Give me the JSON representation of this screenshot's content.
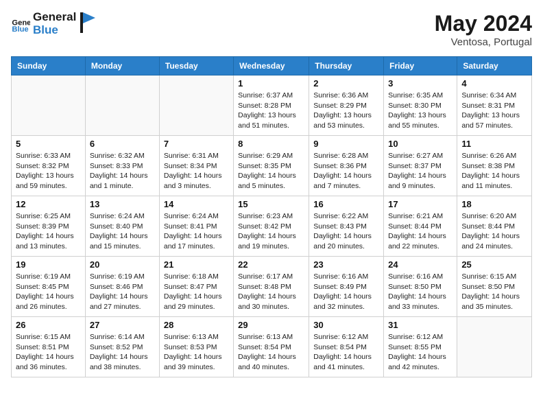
{
  "header": {
    "logo_general": "General",
    "logo_blue": "Blue",
    "month": "May 2024",
    "location": "Ventosa, Portugal"
  },
  "days_of_week": [
    "Sunday",
    "Monday",
    "Tuesday",
    "Wednesday",
    "Thursday",
    "Friday",
    "Saturday"
  ],
  "weeks": [
    [
      {
        "num": "",
        "info": ""
      },
      {
        "num": "",
        "info": ""
      },
      {
        "num": "",
        "info": ""
      },
      {
        "num": "1",
        "info": "Sunrise: 6:37 AM\nSunset: 8:28 PM\nDaylight: 13 hours\nand 51 minutes."
      },
      {
        "num": "2",
        "info": "Sunrise: 6:36 AM\nSunset: 8:29 PM\nDaylight: 13 hours\nand 53 minutes."
      },
      {
        "num": "3",
        "info": "Sunrise: 6:35 AM\nSunset: 8:30 PM\nDaylight: 13 hours\nand 55 minutes."
      },
      {
        "num": "4",
        "info": "Sunrise: 6:34 AM\nSunset: 8:31 PM\nDaylight: 13 hours\nand 57 minutes."
      }
    ],
    [
      {
        "num": "5",
        "info": "Sunrise: 6:33 AM\nSunset: 8:32 PM\nDaylight: 13 hours\nand 59 minutes."
      },
      {
        "num": "6",
        "info": "Sunrise: 6:32 AM\nSunset: 8:33 PM\nDaylight: 14 hours\nand 1 minute."
      },
      {
        "num": "7",
        "info": "Sunrise: 6:31 AM\nSunset: 8:34 PM\nDaylight: 14 hours\nand 3 minutes."
      },
      {
        "num": "8",
        "info": "Sunrise: 6:29 AM\nSunset: 8:35 PM\nDaylight: 14 hours\nand 5 minutes."
      },
      {
        "num": "9",
        "info": "Sunrise: 6:28 AM\nSunset: 8:36 PM\nDaylight: 14 hours\nand 7 minutes."
      },
      {
        "num": "10",
        "info": "Sunrise: 6:27 AM\nSunset: 8:37 PM\nDaylight: 14 hours\nand 9 minutes."
      },
      {
        "num": "11",
        "info": "Sunrise: 6:26 AM\nSunset: 8:38 PM\nDaylight: 14 hours\nand 11 minutes."
      }
    ],
    [
      {
        "num": "12",
        "info": "Sunrise: 6:25 AM\nSunset: 8:39 PM\nDaylight: 14 hours\nand 13 minutes."
      },
      {
        "num": "13",
        "info": "Sunrise: 6:24 AM\nSunset: 8:40 PM\nDaylight: 14 hours\nand 15 minutes."
      },
      {
        "num": "14",
        "info": "Sunrise: 6:24 AM\nSunset: 8:41 PM\nDaylight: 14 hours\nand 17 minutes."
      },
      {
        "num": "15",
        "info": "Sunrise: 6:23 AM\nSunset: 8:42 PM\nDaylight: 14 hours\nand 19 minutes."
      },
      {
        "num": "16",
        "info": "Sunrise: 6:22 AM\nSunset: 8:43 PM\nDaylight: 14 hours\nand 20 minutes."
      },
      {
        "num": "17",
        "info": "Sunrise: 6:21 AM\nSunset: 8:44 PM\nDaylight: 14 hours\nand 22 minutes."
      },
      {
        "num": "18",
        "info": "Sunrise: 6:20 AM\nSunset: 8:44 PM\nDaylight: 14 hours\nand 24 minutes."
      }
    ],
    [
      {
        "num": "19",
        "info": "Sunrise: 6:19 AM\nSunset: 8:45 PM\nDaylight: 14 hours\nand 26 minutes."
      },
      {
        "num": "20",
        "info": "Sunrise: 6:19 AM\nSunset: 8:46 PM\nDaylight: 14 hours\nand 27 minutes."
      },
      {
        "num": "21",
        "info": "Sunrise: 6:18 AM\nSunset: 8:47 PM\nDaylight: 14 hours\nand 29 minutes."
      },
      {
        "num": "22",
        "info": "Sunrise: 6:17 AM\nSunset: 8:48 PM\nDaylight: 14 hours\nand 30 minutes."
      },
      {
        "num": "23",
        "info": "Sunrise: 6:16 AM\nSunset: 8:49 PM\nDaylight: 14 hours\nand 32 minutes."
      },
      {
        "num": "24",
        "info": "Sunrise: 6:16 AM\nSunset: 8:50 PM\nDaylight: 14 hours\nand 33 minutes."
      },
      {
        "num": "25",
        "info": "Sunrise: 6:15 AM\nSunset: 8:50 PM\nDaylight: 14 hours\nand 35 minutes."
      }
    ],
    [
      {
        "num": "26",
        "info": "Sunrise: 6:15 AM\nSunset: 8:51 PM\nDaylight: 14 hours\nand 36 minutes."
      },
      {
        "num": "27",
        "info": "Sunrise: 6:14 AM\nSunset: 8:52 PM\nDaylight: 14 hours\nand 38 minutes."
      },
      {
        "num": "28",
        "info": "Sunrise: 6:13 AM\nSunset: 8:53 PM\nDaylight: 14 hours\nand 39 minutes."
      },
      {
        "num": "29",
        "info": "Sunrise: 6:13 AM\nSunset: 8:54 PM\nDaylight: 14 hours\nand 40 minutes."
      },
      {
        "num": "30",
        "info": "Sunrise: 6:12 AM\nSunset: 8:54 PM\nDaylight: 14 hours\nand 41 minutes."
      },
      {
        "num": "31",
        "info": "Sunrise: 6:12 AM\nSunset: 8:55 PM\nDaylight: 14 hours\nand 42 minutes."
      },
      {
        "num": "",
        "info": ""
      }
    ]
  ]
}
